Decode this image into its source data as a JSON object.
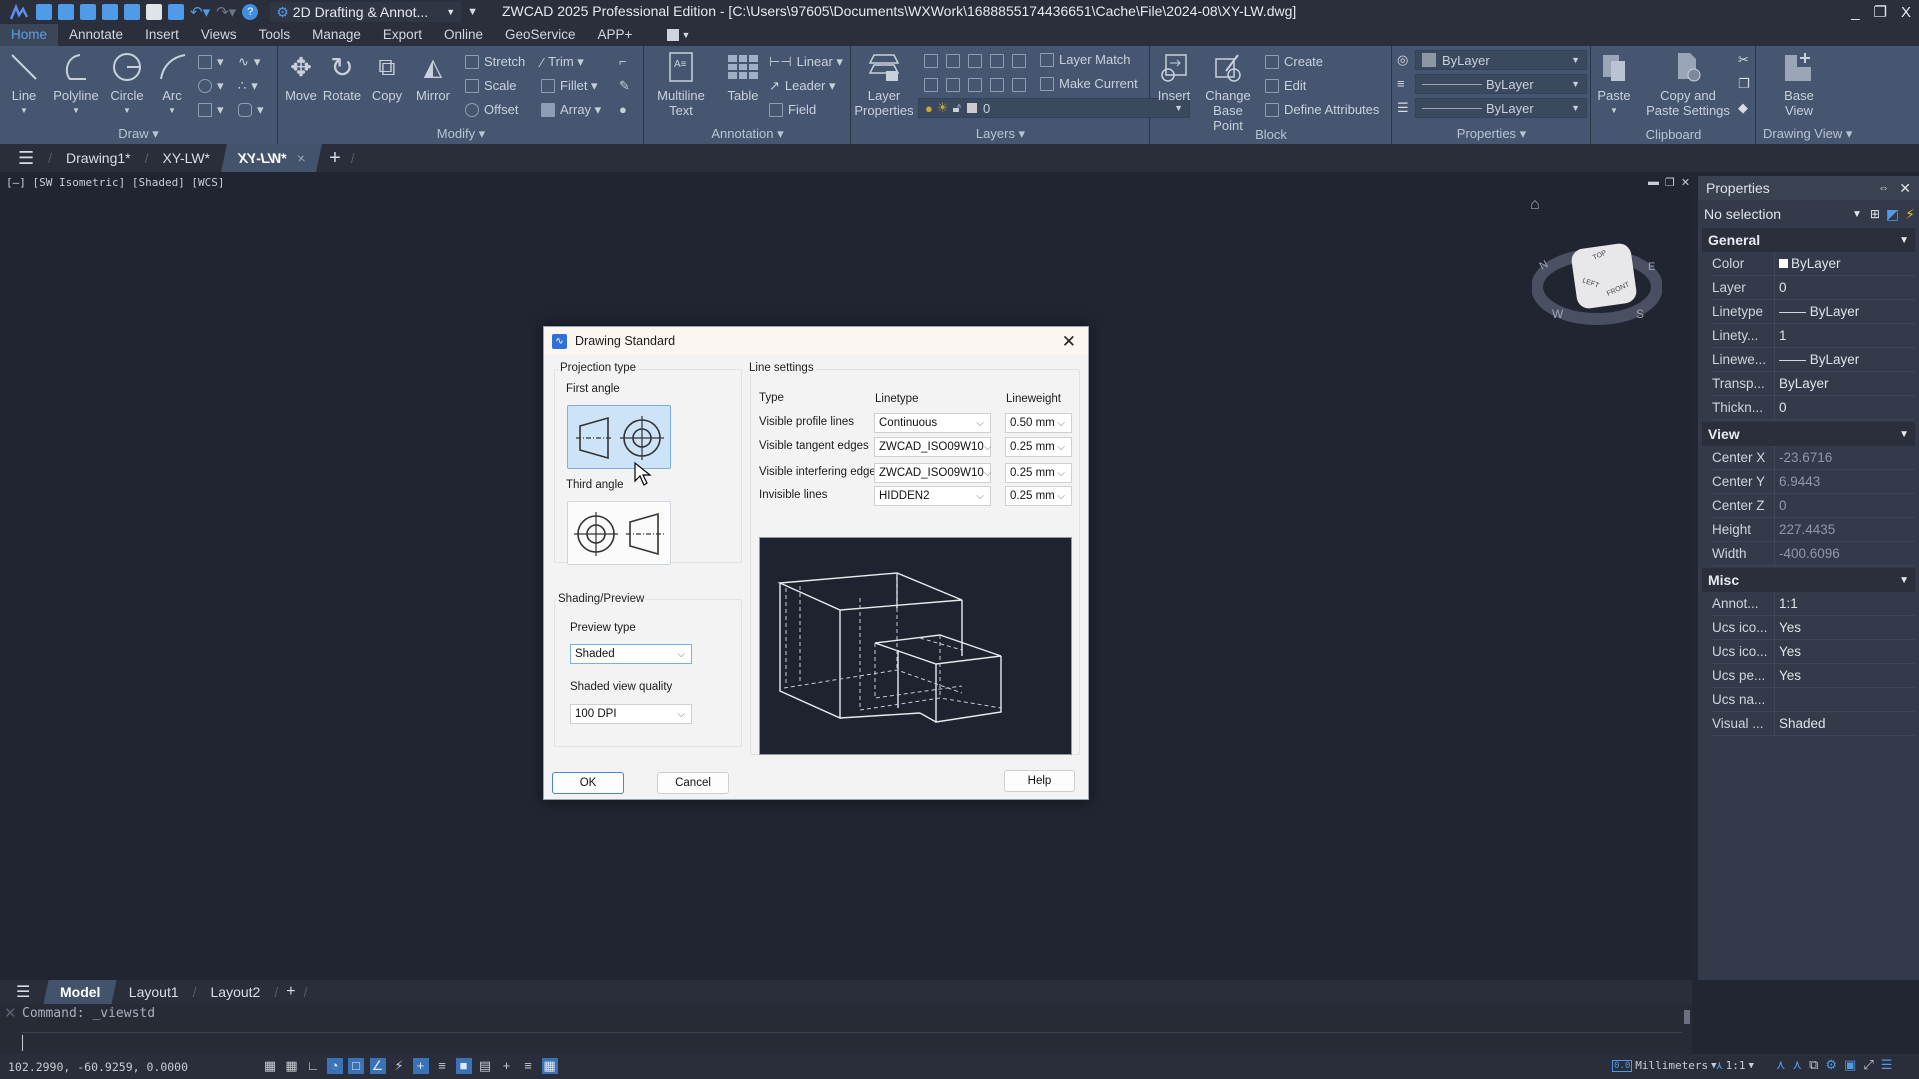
{
  "titlebar": {
    "workspace": "2D Drafting & Annot...",
    "title": "ZWCAD 2025 Professional Edition - [C:\\Users\\97605\\Documents\\WXWork\\1688855174436651\\Cache\\File\\2024-08\\XY-LW.dwg]",
    "minimize": "_",
    "restore": "❐",
    "close": "X"
  },
  "menu": {
    "tabs": [
      "Home",
      "Annotate",
      "Insert",
      "Views",
      "Tools",
      "Manage",
      "Export",
      "Online",
      "GeoService",
      "APP+"
    ],
    "active": "Home"
  },
  "ribbon": {
    "draw": {
      "title": "Draw ▾",
      "buttons": [
        "Line",
        "Polyline",
        "Circle",
        "Arc"
      ]
    },
    "modify": {
      "title": "Modify ▾",
      "big": [
        "Move",
        "Rotate",
        "Copy",
        "Mirror"
      ],
      "small": [
        "Stretch",
        "Scale",
        "Offset",
        "Trim ▾",
        "Fillet ▾",
        "Array ▾"
      ]
    },
    "annotation": {
      "title": "Annotation ▾",
      "big": [
        "Multiline Text",
        "Table"
      ],
      "small": [
        "Linear ▾",
        "Leader ▾",
        "Field"
      ]
    },
    "layers": {
      "title": "Layers ▾",
      "big": "Layer Properties",
      "small": [
        "Layer Match",
        "Make Current"
      ],
      "layer_value": "0"
    },
    "block": {
      "title": "Block",
      "big": [
        "Insert",
        "Change Base Point"
      ],
      "small": [
        "Create",
        "Edit",
        "Define Attributes"
      ]
    },
    "properties": {
      "title": "Properties ▾",
      "color": "ByLayer",
      "linetype": "ByLayer",
      "lineweight": "ByLayer"
    },
    "clipboard": {
      "title": "Clipboard",
      "big": [
        "Paste",
        "Copy and Paste Settings"
      ]
    },
    "drawing_view": {
      "title": "Drawing View ▾",
      "big": [
        "Base View"
      ]
    }
  },
  "doc_tabs": {
    "tabs": [
      "Drawing1*",
      "XY-LW*",
      "XY-LW*"
    ],
    "active_index": 2,
    "close": "×",
    "add": "+"
  },
  "viewport": {
    "label": "[—] [SW Isometric] [Shaded] [WCS]",
    "viewcube": {
      "top": "TOP",
      "left": "LEFT",
      "front": "FRONT",
      "compass": [
        "N",
        "E",
        "S",
        "W"
      ]
    }
  },
  "properties_panel": {
    "title": "Properties",
    "selection": "No selection",
    "sections": [
      {
        "name": "General",
        "rows": [
          {
            "k": "Color",
            "v": "ByLayer"
          },
          {
            "k": "Layer",
            "v": "0"
          },
          {
            "k": "Linetype",
            "v": "—— ByLayer"
          },
          {
            "k": "Linety...",
            "v": "1"
          },
          {
            "k": "Linewe...",
            "v": "—— ByLayer"
          },
          {
            "k": "Transp...",
            "v": "ByLayer"
          },
          {
            "k": "Thickn...",
            "v": "0"
          }
        ]
      },
      {
        "name": "View",
        "rows": [
          {
            "k": "Center X",
            "v": "-23.6716"
          },
          {
            "k": "Center Y",
            "v": "6.9443"
          },
          {
            "k": "Center Z",
            "v": "0"
          },
          {
            "k": "Height",
            "v": "227.4435"
          },
          {
            "k": "Width",
            "v": "-400.6096"
          }
        ]
      },
      {
        "name": "Misc",
        "rows": [
          {
            "k": "Annot...",
            "v": "1:1"
          },
          {
            "k": "Ucs ico...",
            "v": "Yes"
          },
          {
            "k": "Ucs ico...",
            "v": "Yes"
          },
          {
            "k": "Ucs pe...",
            "v": "Yes"
          },
          {
            "k": "Ucs na...",
            "v": ""
          },
          {
            "k": "Visual ...",
            "v": "Shaded"
          }
        ]
      }
    ]
  },
  "layout_tabs": {
    "tabs": [
      "Model",
      "Layout1",
      "Layout2"
    ],
    "active": "Model",
    "add": "+"
  },
  "command": {
    "history": "Command: _viewstd",
    "input": ""
  },
  "status": {
    "coords": "102.2990, -60.9259, 0.0000",
    "units": "Millimeters",
    "scale": "1:1"
  },
  "dialog": {
    "title": "Drawing Standard",
    "projection_group": "Projection type",
    "first_angle": "First angle",
    "third_angle": "Third angle",
    "selected_projection": "First angle",
    "line_settings_group": "Line settings",
    "columns": [
      "Type",
      "Linetype",
      "Lineweight"
    ],
    "rows": [
      {
        "type": "Visible profile lines",
        "linetype": "Continuous",
        "lineweight": "0.50 mm"
      },
      {
        "type": "Visible tangent edges",
        "linetype": "ZWCAD_ISO09W10",
        "lineweight": "0.25 mm"
      },
      {
        "type": "Visible interfering edges",
        "linetype": "ZWCAD_ISO09W10",
        "lineweight": "0.25 mm"
      },
      {
        "type": "Invisible lines",
        "linetype": "HIDDEN2",
        "lineweight": "0.25 mm"
      }
    ],
    "shading_group": "Shading/Preview",
    "preview_type_label": "Preview type",
    "preview_type": "Shaded",
    "quality_label": "Shaded view quality",
    "quality": "100 DPI",
    "ok": "OK",
    "cancel": "Cancel",
    "help": "Help"
  }
}
